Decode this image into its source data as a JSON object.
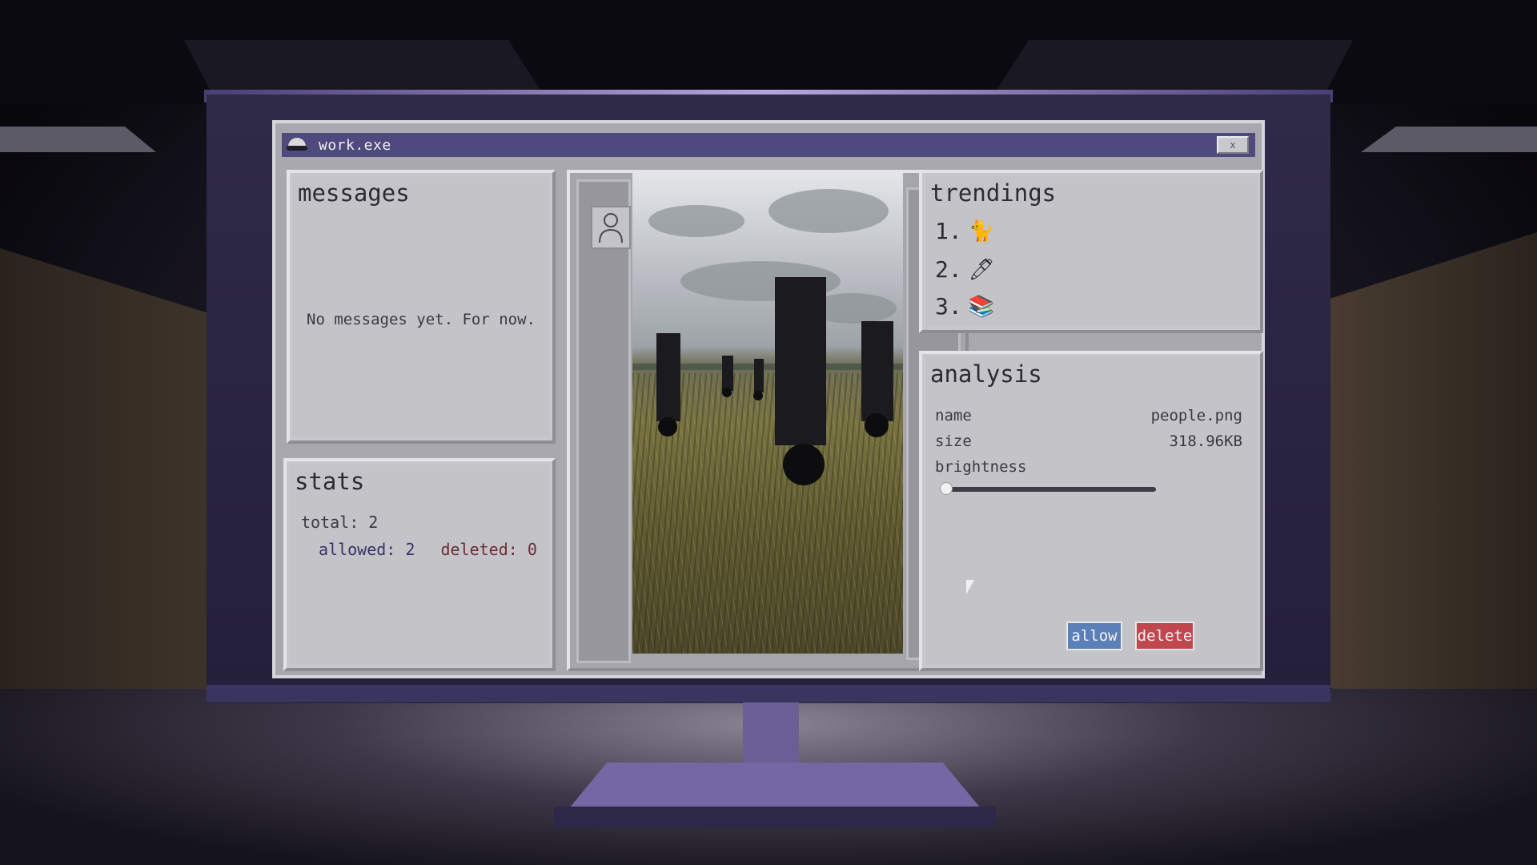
{
  "window": {
    "title": "work.exe",
    "close_label": "x"
  },
  "messages": {
    "heading": "messages",
    "empty_text": "No messages yet. For now."
  },
  "stats": {
    "heading": "stats",
    "total": "total: 2",
    "allowed": "allowed: 2",
    "deleted": "deleted: 0"
  },
  "trendings": {
    "heading": "trendings",
    "items": [
      {
        "rank": "1.",
        "icon": "cat-icon",
        "glyph": "🐈"
      },
      {
        "rank": "2.",
        "icon": "pen-icon",
        "glyph": "🖊"
      },
      {
        "rank": "3.",
        "icon": "book-icon",
        "glyph": "📚"
      }
    ]
  },
  "analysis": {
    "heading": "analysis",
    "name_label": "name",
    "name_value": "people.png",
    "size_label": "size",
    "size_value": "318.96KB",
    "brightness_label": "brightness",
    "brightness_level": 0.0,
    "allow_label": "allow",
    "delete_label": "delete"
  },
  "colors": {
    "titlebar": "#4e4a7e",
    "allow": "#5b7fb7",
    "delete": "#c1474e",
    "bezel": "#2f2a48"
  }
}
